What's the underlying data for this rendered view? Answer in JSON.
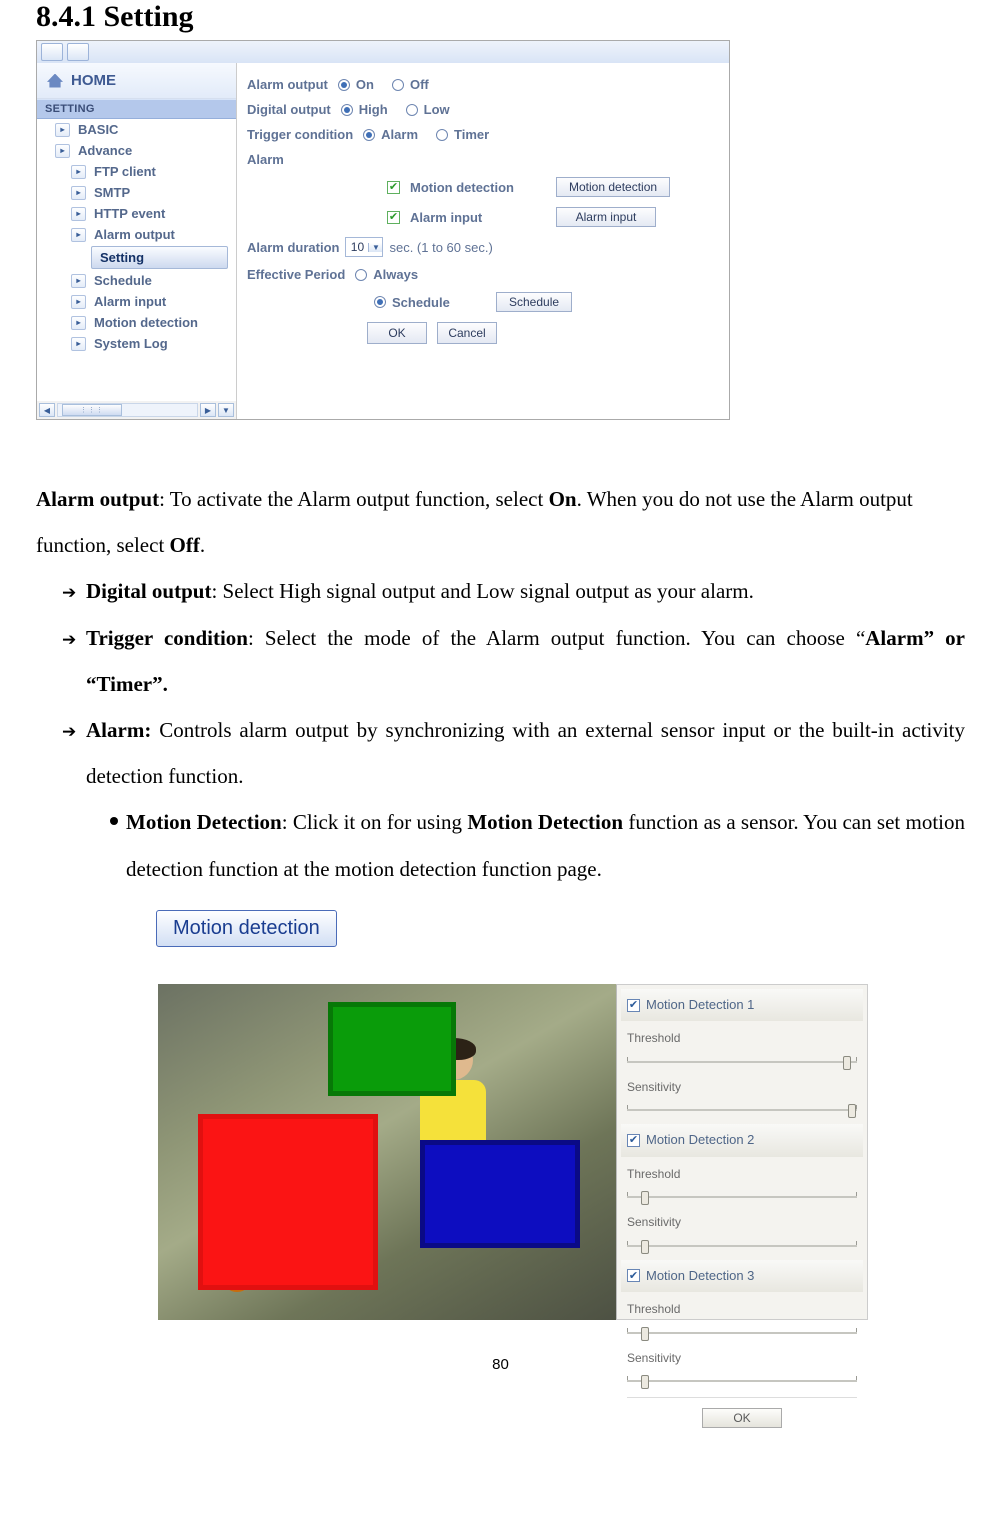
{
  "heading": "8.4.1 Setting",
  "sidebar": {
    "home": "HOME",
    "section": "SETTING",
    "basic": "BASIC",
    "advance": "Advance",
    "items": [
      "FTP client",
      "SMTP",
      "HTTP event",
      "Alarm output"
    ],
    "selected": "Setting",
    "items2": [
      "Schedule",
      "Alarm input",
      "Motion detection",
      "System Log"
    ]
  },
  "form": {
    "alarm_output": {
      "label": "Alarm output",
      "on": "On",
      "off": "Off"
    },
    "digital_output": {
      "label": "Digital output",
      "high": "High",
      "low": "Low"
    },
    "trigger": {
      "label": "Trigger condition",
      "alarm": "Alarm",
      "timer": "Timer"
    },
    "alarm_section": "Alarm",
    "motion_detection": "Motion detection",
    "motion_detection_btn": "Motion detection",
    "alarm_input": "Alarm input",
    "alarm_input_btn": "Alarm input",
    "duration_label": "Alarm duration",
    "duration_value": "10",
    "duration_suffix": "sec. (1 to 60 sec.)",
    "effective": {
      "label": "Effective Period",
      "always": "Always",
      "schedule": "Schedule",
      "schedule_btn": "Schedule"
    },
    "ok": "OK",
    "cancel": "Cancel"
  },
  "text": {
    "p1a": "Alarm output",
    "p1b": ": To activate the Alarm output function, select ",
    "p1c": "On",
    "p1d": ". When you do not use the Alarm output function, select ",
    "p1e": "Off",
    "p1f": ".",
    "d1a": "Digital output",
    "d1b": ": Select High signal output and Low signal output as your alarm.",
    "t1a": "Trigger condition",
    "t1b": ": Select the mode of the Alarm output function. You can choose “",
    "t1c": "Alarm” or “Timer”.",
    "a1a": "Alarm:",
    "a1b": " Controls alarm output by synchronizing with an external sensor input or the built-in activity detection function.",
    "m1a": "Motion Detection",
    "m1b": ": Click it on for using ",
    "m1c": "Motion Detection",
    "m1d": " function as a sensor. You can set motion detection function at the motion detection function page."
  },
  "mdbtn": "Motion detection",
  "md_panel": {
    "groups": [
      {
        "name": "Motion Detection 1",
        "threshold": "Threshold",
        "sensitivity": "Sensitivity",
        "knob1": 94,
        "knob2": 96
      },
      {
        "name": "Motion Detection 2",
        "threshold": "Threshold",
        "sensitivity": "Sensitivity",
        "knob1": 6,
        "knob2": 6
      },
      {
        "name": "Motion Detection 3",
        "threshold": "Threshold",
        "sensitivity": "Sensitivity",
        "knob1": 6,
        "knob2": 6
      }
    ],
    "ok": "OK"
  },
  "page": "80"
}
